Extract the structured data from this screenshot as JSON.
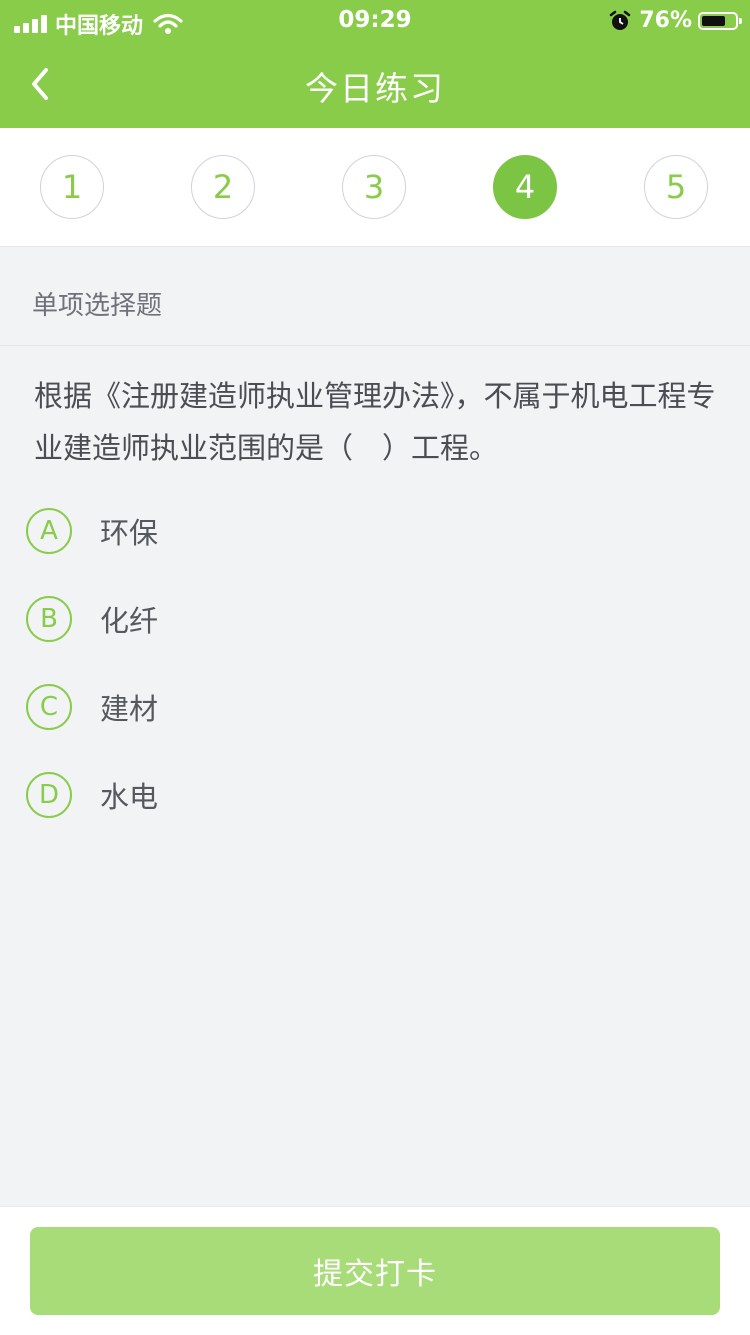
{
  "status_bar": {
    "carrier": "中国移动",
    "time": "09:29",
    "battery_percent": "76%",
    "battery_level": 0.76
  },
  "header": {
    "title": "今日练习"
  },
  "steps": [
    {
      "label": "1",
      "active": false
    },
    {
      "label": "2",
      "active": false
    },
    {
      "label": "3",
      "active": false
    },
    {
      "label": "4",
      "active": true
    },
    {
      "label": "5",
      "active": false
    }
  ],
  "question": {
    "type": "单项选择题",
    "text": "根据《注册建造师执业管理办法》，不属于机电工程专业建造师执业范围的是（　）工程。",
    "options": [
      {
        "letter": "A",
        "text": "环保"
      },
      {
        "letter": "B",
        "text": "化纤"
      },
      {
        "letter": "C",
        "text": "建材"
      },
      {
        "letter": "D",
        "text": "水电"
      }
    ]
  },
  "footer": {
    "submit_label": "提交打卡"
  },
  "colors": {
    "accent": "#88cc4a",
    "active_step": "#7cc444",
    "submit_disabled": "#a8dc78"
  }
}
